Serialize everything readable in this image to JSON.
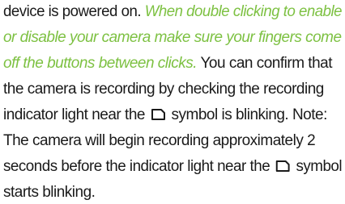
{
  "document": {
    "line1": {
      "plain": "device is powered on. ",
      "italic": "When double clicking to enable"
    },
    "line2": {
      "italic": "or disable your camera make sure your fingers come"
    },
    "line3": {
      "italic": "off the buttons between clicks.",
      "plain": " You can confirm that"
    },
    "line4": {
      "plain": "the camera is recording by checking the recording"
    },
    "line5": {
      "plain_before": "indicator light near the",
      "plain_after": "symbol is blinking. Note:"
    },
    "line6": {
      "plain": "The camera will begin recording approximately 2"
    },
    "line7": {
      "plain_before": "seconds before the indicator light near the",
      "plain_after": "symbol"
    },
    "line8": {
      "plain": "starts blinking."
    },
    "symbol_icon": "card-slot-icon",
    "accent_color": "#7dc142",
    "text_color": "#1a1a1a"
  }
}
